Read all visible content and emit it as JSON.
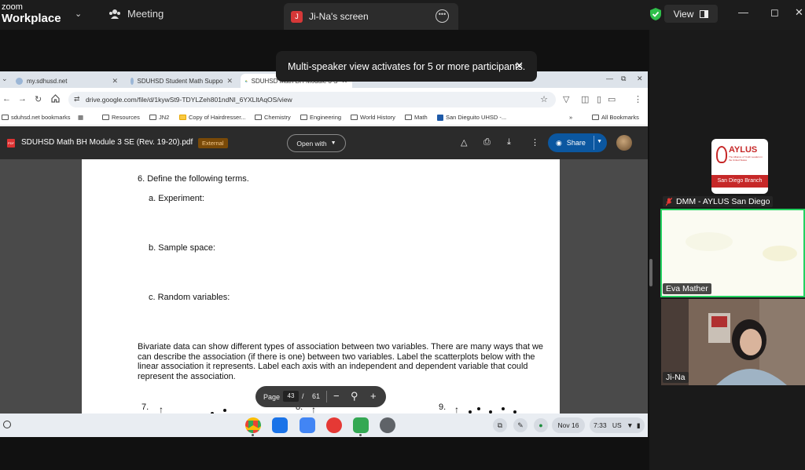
{
  "zoom": {
    "logo_line1": "zoom",
    "logo_line2": "Workplace",
    "meeting_label": "Meeting",
    "screen_tab_initial": "J",
    "screen_tab_label": "Ji-Na's screen",
    "view_label": "View",
    "banner_text": "Multi-speaker view activates for 5 or more participants."
  },
  "browser": {
    "tabs": [
      {
        "label": "my.sdhusd.net"
      },
      {
        "label": "SDUHSD Student Math Suppo"
      },
      {
        "label": "SDUHSD Math BH Module 3 S"
      }
    ],
    "url": "drive.google.com/file/d/1kywSt9-TDYLZeh801ndNI_6YXLltAqOS/view",
    "bookmarks": [
      "sduhsd.net bookmarks",
      "Resources",
      "JN2",
      "Copy of Hairdresser...",
      "Chemistry",
      "Engineering",
      "World History",
      "Math",
      "San Dieguito UHSD -..."
    ],
    "all_bookmarks": "All Bookmarks"
  },
  "drive": {
    "pdf_icon_text": "PDF",
    "title": "SDUHSD Math BH Module 3 SE (Rev. 19-20).pdf",
    "external_badge": "External",
    "open_with": "Open with",
    "share": "Share"
  },
  "document": {
    "q6": "6. Define the following terms.",
    "q6a": "a. Experiment:",
    "q6b": "b. Sample space:",
    "q6c": "c. Random variables:",
    "paragraph": "Bivariate data can show different types of association between two variables. There are many ways that we can describe the association (if there is one) between two variables. Label the scatterplots below with the linear association it represents. Label each axis with an independent and dependent variable that could represent the association.",
    "q7": "7.",
    "q8": "8.",
    "q9": "9."
  },
  "pager": {
    "page_label": "Page",
    "current": "43",
    "slash": "/",
    "total": "61"
  },
  "taskbar": {
    "date": "Nov 16",
    "time": "7:33",
    "region": "US"
  },
  "participants": {
    "aylus_logo_word": "AYLUS",
    "aylus_logo_sub": "The Alliance of Youth Leaders in the United States",
    "aylus_branch": "San Diego Branch",
    "dmm_name": "DMM - AYLUS San Diego",
    "eva_name": "Eva Mather",
    "jina_name": "Ji-Na"
  }
}
